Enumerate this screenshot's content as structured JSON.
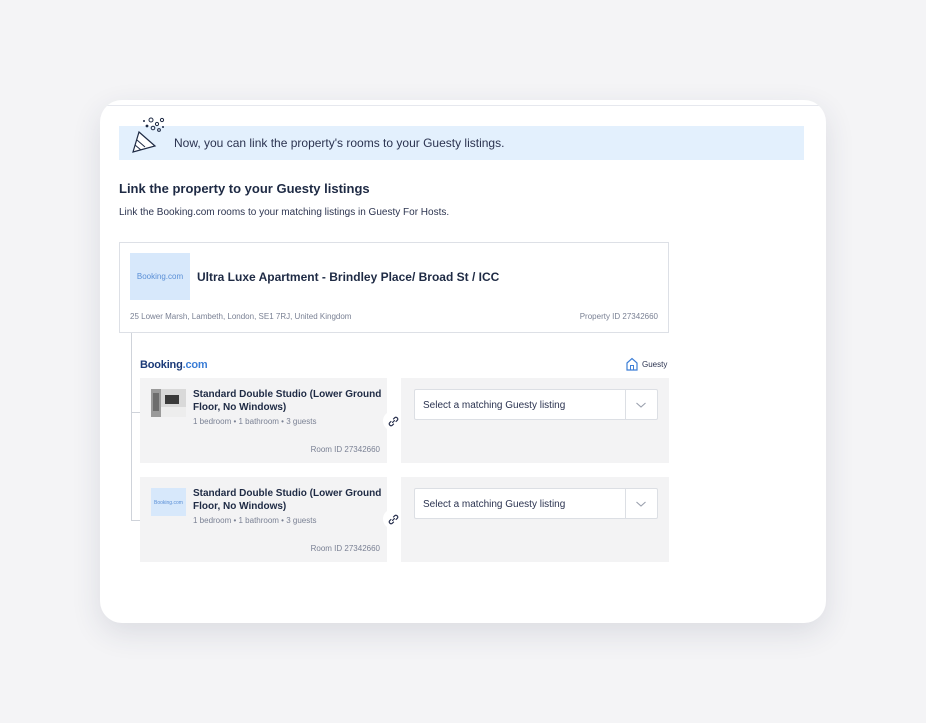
{
  "banner": {
    "text": "Now, you can link the property's rooms to your Guesty listings."
  },
  "section": {
    "title": "Link the property to your Guesty listings",
    "subtitle": "Link the Booking.com rooms to your matching listings in Guesty For Hosts."
  },
  "property": {
    "logo_text": "Booking.com",
    "name": "Ultra Luxe Apartment - Brindley Place/ Broad St / ICC",
    "address": "25 Lower Marsh, Lambeth, London, SE1 7RJ, United Kingdom",
    "id_label": "Property ID 27342660"
  },
  "brands": {
    "booking_main": "Booking",
    "booking_suffix": ".com",
    "guesty": "Guesty"
  },
  "rooms": [
    {
      "title": "Standard Double Studio (Lower Ground Floor, No Windows)",
      "meta": "1 bedroom  • 1 bathroom • 3 guests",
      "id_label": "Room ID 27342660",
      "thumb": "photo"
    },
    {
      "title": "Standard Double Studio (Lower Ground Floor, No Windows)",
      "meta": "1 bedroom  • 1 bathroom • 3 guests",
      "id_label": "Room ID 27342660",
      "thumb": "logo",
      "thumb_text": "Booking.com"
    }
  ],
  "select": {
    "placeholder": "Select a matching Guesty listing"
  },
  "colors": {
    "banner_bg": "#e3f0fd",
    "booking_blue": "#1b3a78",
    "accent_blue": "#3c7ed6",
    "panel_bg": "#f3f3f4"
  }
}
